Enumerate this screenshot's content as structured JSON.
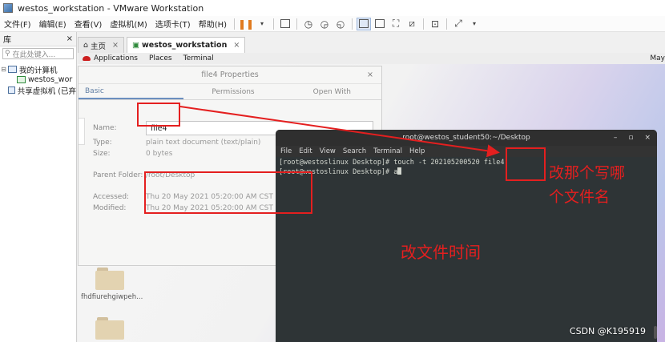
{
  "window": {
    "title": "westos_workstation - VMware Workstation"
  },
  "menu": [
    "文件(F)",
    "编辑(E)",
    "查看(V)",
    "虚拟机(M)",
    "选项卡(T)",
    "帮助(H)"
  ],
  "library": {
    "title": "库",
    "search_placeholder": "在此处键入...",
    "tree": [
      {
        "label": "我的计算机",
        "expander": "⊟"
      },
      {
        "label": "westos_wor"
      },
      {
        "label": "共享虚拟机 (已弃"
      }
    ]
  },
  "tabs": [
    {
      "label": "主页",
      "close": "×"
    },
    {
      "label": "westos_workstation",
      "close": "×"
    }
  ],
  "gnome": {
    "menus": [
      "Applications",
      "Places",
      "Terminal"
    ],
    "right": "May"
  },
  "properties": {
    "title": "file4 Properties",
    "close": "×",
    "tabs": [
      "Basic",
      "Permissions",
      "Open With"
    ],
    "fields": {
      "name_label": "Name:",
      "name_value": "file4",
      "type_label": "Type:",
      "type_value": "plain text document (text/plain)",
      "size_label": "Size:",
      "size_value": "0 bytes",
      "parent_label": "Parent Folder:",
      "parent_value": "/root/Desktop",
      "accessed_label": "Accessed:",
      "accessed_value": "Thu 20 May 2021 05:20:00 AM CST",
      "modified_label": "Modified:",
      "modified_value": "Thu 20 May 2021 05:20:00 AM CST"
    }
  },
  "desktop": {
    "folder_label": "fhdfiurehgiwpeh..."
  },
  "terminal": {
    "title": "root@westos_student50:~/Desktop",
    "controls": [
      "–",
      "▫",
      "×"
    ],
    "menu": [
      "File",
      "Edit",
      "View",
      "Search",
      "Terminal",
      "Help"
    ],
    "line1": "[root@westoslinux Desktop]# touch -t 202105200520 file4",
    "line2_prompt": "[root@westoslinux Desktop]# a"
  },
  "annotations": {
    "change_filename_line1": "改那个写哪",
    "change_filename_line2": "个文件名",
    "change_time": "改文件时间",
    "color": "#e41f1f"
  },
  "watermark": "CSDN @K195919"
}
